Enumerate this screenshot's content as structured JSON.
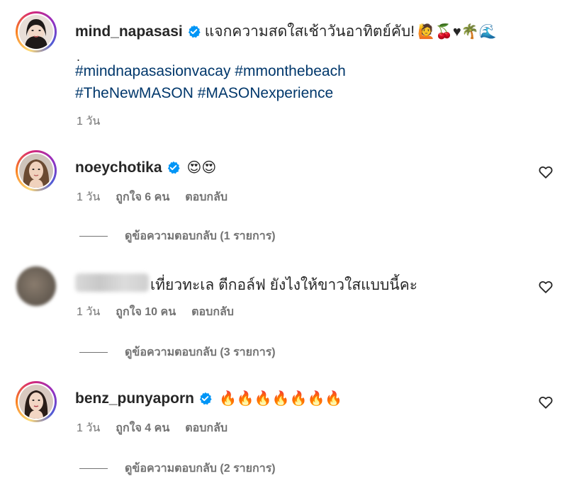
{
  "post": {
    "username": "mind_napasasi",
    "caption": "แจกความสดใสเช้าวันอาทิตย์คับ!",
    "caption_emojis": "🙋🍒♥🌴🌊",
    "dot": ".",
    "hashtags_line1": "#mindnapasasionvacay #mmonthebeach",
    "hashtags_line2": "#TheNewMASON #MASONexperience",
    "time": "1 วัน"
  },
  "comments": [
    {
      "username": "noeychotika",
      "text": "😍😍",
      "time": "1 วัน",
      "likes": "ถูกใจ 6 คน",
      "reply": "ตอบกลับ",
      "view_replies": "ดูข้อความตอบกลับ (1 รายการ)"
    },
    {
      "username": "",
      "text": "เที่ยวทะเล ตีกอล์ฟ ยังไงให้ขาวใสแบบนี้คะ",
      "time": "1 วัน",
      "likes": "ถูกใจ 10 คน",
      "reply": "ตอบกลับ",
      "view_replies": "ดูข้อความตอบกลับ (3 รายการ)"
    },
    {
      "username": "benz_punyaporn",
      "text": "🔥🔥🔥🔥🔥🔥🔥",
      "time": "1 วัน",
      "likes": "ถูกใจ 4 คน",
      "reply": "ตอบกลับ",
      "view_replies": "ดูข้อความตอบกลับ (2 รายการ)"
    }
  ],
  "colors": {
    "hashtag": "#00376b",
    "verified": "#0095f6",
    "meta": "#737373"
  }
}
